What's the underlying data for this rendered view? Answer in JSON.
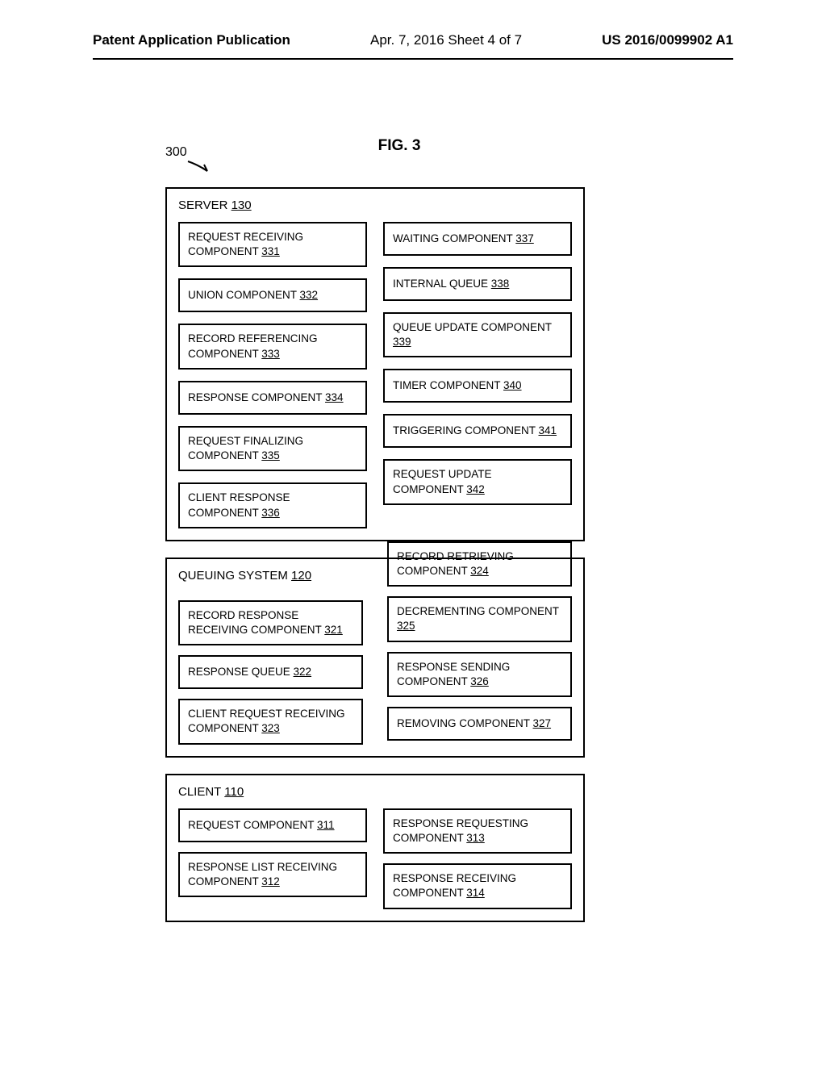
{
  "header": {
    "pubtype": "Patent Application Publication",
    "center": "Apr. 7, 2016  Sheet 4 of 7",
    "docnum": "US 2016/0099902 A1"
  },
  "figure": {
    "title": "FIG. 3",
    "ref": "300"
  },
  "server": {
    "title_prefix": "SERVER ",
    "title_num": "130",
    "left": [
      {
        "text_prefix": "REQUEST RECEIVING COMPONENT  ",
        "num": "331"
      },
      {
        "text_prefix": "UNION COMPONENT   ",
        "num": "332"
      },
      {
        "text_prefix": "RECORD REFERENCING COMPONENT ",
        "num": "333"
      },
      {
        "text_prefix": "RESPONSE COMPONENT ",
        "num": "334"
      },
      {
        "text_prefix": "REQUEST FINALIZING COMPONENT  ",
        "num": "335"
      },
      {
        "text_prefix": "CLIENT RESPONSE COMPONENT  ",
        "num": "336"
      }
    ],
    "right": [
      {
        "text_prefix": "WAITING COMPONENT   ",
        "num": "337"
      },
      {
        "text_prefix": "INTERNAL QUEUE ",
        "num": "338"
      },
      {
        "text_prefix": "QUEUE UPDATE COMPONENT  ",
        "num": "339"
      },
      {
        "text_prefix": "TIMER COMPONENT   ",
        "num": "340"
      },
      {
        "text_prefix": "TRIGGERING COMPONENT ",
        "num": "341"
      },
      {
        "text_prefix": "REQUEST UPDATE COMPONENT  ",
        "num": "342"
      }
    ]
  },
  "queuing": {
    "title_prefix": "QUEUING SYSTEM  ",
    "title_num": "120",
    "left": [
      {
        "text_prefix": "RECORD RESPONSE RECEIVING COMPONENT  ",
        "num": "321"
      },
      {
        "text_prefix": "RESPONSE QUEUE ",
        "num": "322"
      },
      {
        "text_prefix": "CLIENT REQUEST RECEIVING COMPONENT  ",
        "num": "323"
      }
    ],
    "right": [
      {
        "text_prefix": "RECORD RETRIEVING COMPONENT  ",
        "num": "324"
      },
      {
        "text_prefix": "DECREMENTING COMPONENT  ",
        "num": "325"
      },
      {
        "text_prefix": "RESPONSE SENDING COMPONENT  ",
        "num": "326"
      },
      {
        "text_prefix": "REMOVING COMPONENT ",
        "num": "327"
      }
    ]
  },
  "client": {
    "title_prefix": "CLIENT  ",
    "title_num": "110",
    "left": [
      {
        "text_prefix": "REQUEST COMPONENT ",
        "num": "311"
      },
      {
        "text_prefix": "RESPONSE LIST RECEIVING COMPONENT  ",
        "num": "312"
      }
    ],
    "right": [
      {
        "text_prefix": "RESPONSE REQUESTING COMPONENT  ",
        "num": "313"
      },
      {
        "text_prefix": "RESPONSE RECEIVING COMPONENT  ",
        "num": "314"
      }
    ]
  }
}
